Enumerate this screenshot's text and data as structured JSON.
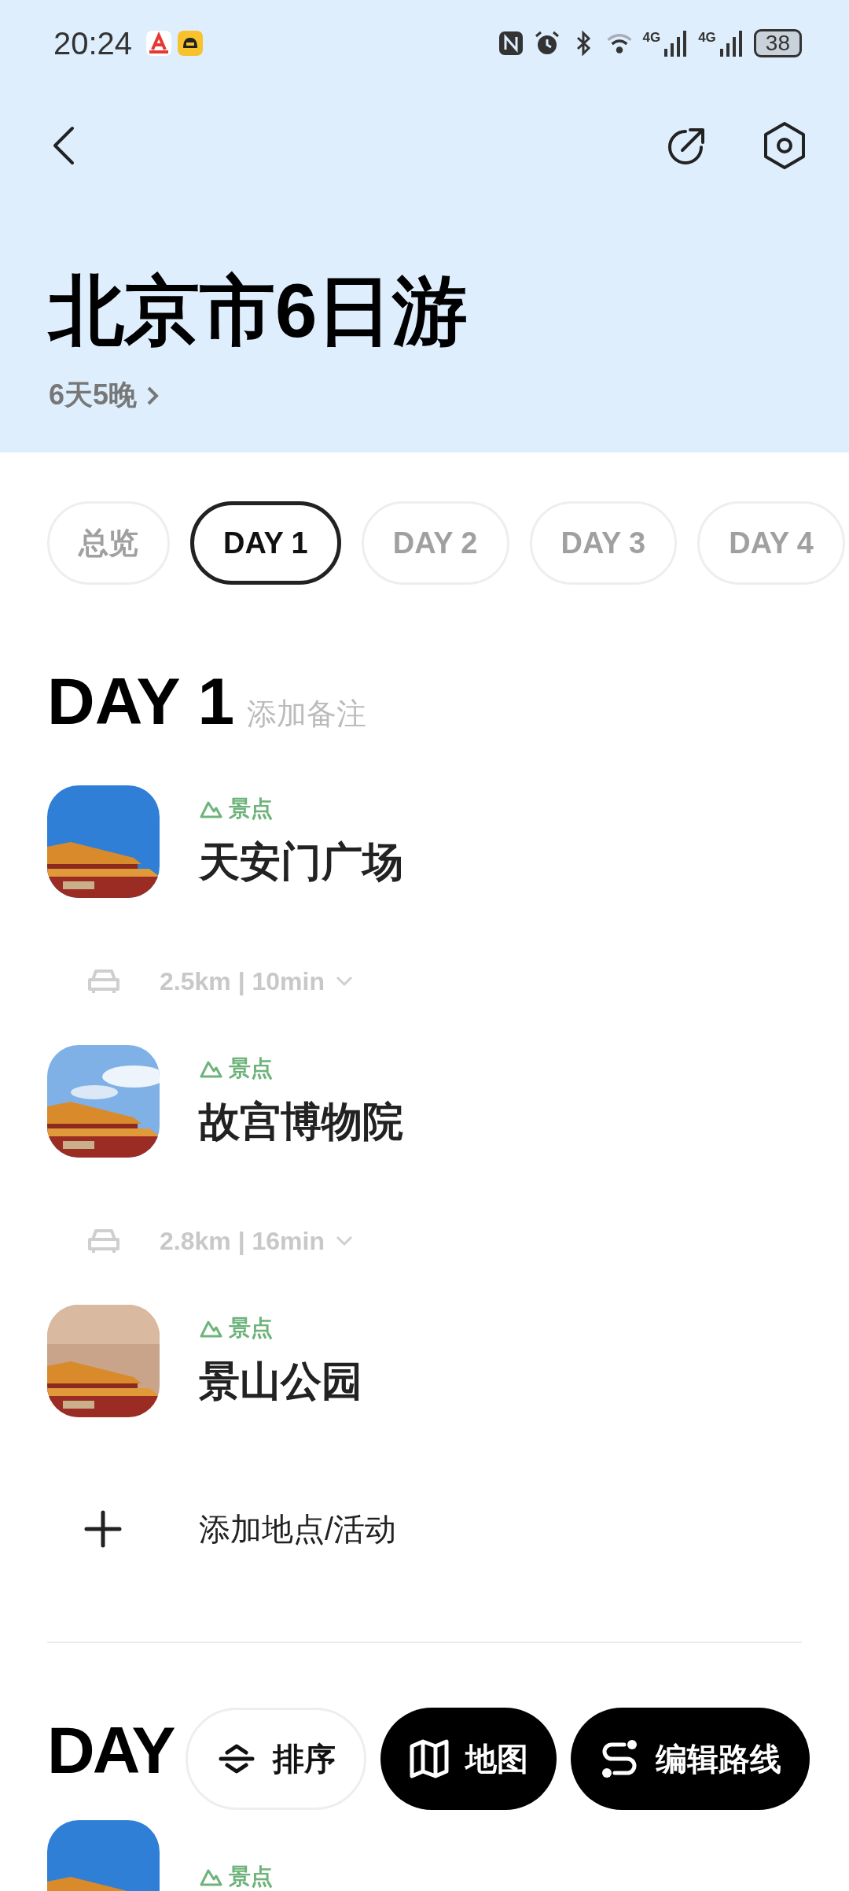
{
  "status_bar": {
    "time": "20:24",
    "network_labels": [
      "4G",
      "4G"
    ],
    "battery": "38"
  },
  "header": {
    "title": "北京市6日游",
    "subtitle": "6天5晚"
  },
  "tabs": [
    {
      "label": "总览",
      "selected": false
    },
    {
      "label": "DAY 1",
      "selected": true
    },
    {
      "label": "DAY 2",
      "selected": false
    },
    {
      "label": "DAY 3",
      "selected": false
    },
    {
      "label": "DAY 4",
      "selected": false
    }
  ],
  "days": [
    {
      "title": "DAY 1",
      "note_hint": "添加备注",
      "add_label": "添加地点/活动",
      "items": [
        {
          "kind": "stop",
          "category": "景点",
          "name": "天安门广场"
        },
        {
          "kind": "leg",
          "route": "2.5km | 10min"
        },
        {
          "kind": "stop",
          "category": "景点",
          "name": "故宫博物院"
        },
        {
          "kind": "leg",
          "route": "2.8km | 16min"
        },
        {
          "kind": "stop",
          "category": "景点",
          "name": "景山公园"
        }
      ]
    },
    {
      "title": "DAY",
      "items": [
        {
          "kind": "stop",
          "category": "景点"
        }
      ]
    }
  ],
  "actions": [
    {
      "kind": "sort",
      "label": "排序"
    },
    {
      "kind": "map",
      "label": "地图"
    },
    {
      "kind": "route",
      "label": "编辑路线"
    }
  ]
}
